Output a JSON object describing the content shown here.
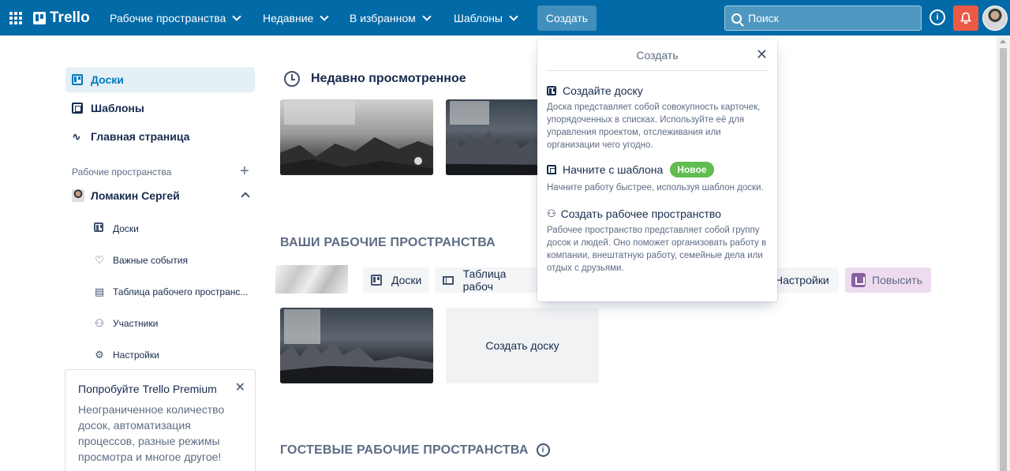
{
  "header": {
    "logo": "Trello",
    "nav": [
      "Рабочие пространства",
      "Недавние",
      "В избранном",
      "Шаблоны"
    ],
    "create": "Создать",
    "search_placeholder": "Поиск",
    "info": "i"
  },
  "sidebar": {
    "items": [
      "Доски",
      "Шаблоны",
      "Главная страница"
    ],
    "workspaces_label": "Рабочие пространства",
    "workspace_name": "Ломакин Сергей",
    "sub_items": [
      "Доски",
      "Важные события",
      "Таблица рабочего пространс...",
      "Участники",
      "Настройки"
    ]
  },
  "promo": {
    "title": "Попробуйте Trello Premium",
    "text": "Неограниченное количество досок, автоматизация процессов, разные режимы просмотра и многое другое!"
  },
  "main": {
    "recent_title": "Недавно просмотренное",
    "your_workspaces": "ВАШИ РАБОЧИЕ ПРОСТРАНСТВА",
    "tabs": [
      "Доски",
      "Таблица рабоч",
      "Настройки"
    ],
    "upgrade": "Повысить",
    "create_board": "Создать доску",
    "guest_workspaces": "ГОСТЕВЫЕ РАБОЧИЕ ПРОСТРАНСТВА"
  },
  "popover": {
    "title": "Создать",
    "items": [
      {
        "title": "Создайте доску",
        "desc": "Доска представляет собой совокупность карточек, упорядоченных в списках. Используйте её для управления проектом, отслеживания или организации чего угодно."
      },
      {
        "title": "Начните с шаблона",
        "badge": "Новое",
        "desc": "Начните работу быстрее, используя шаблон доски."
      },
      {
        "title": "Создать рабочее пространство",
        "desc": "Рабочее пространство представляет собой группу досок и людей. Оно поможет организовать работу в компании, внештатную работу, семейные дела или отдых с друзьями."
      }
    ]
  },
  "colors": {
    "header": "#026aa7",
    "accent": "#0079bf",
    "notification": "#eb5a46",
    "badge": "#61bd4f",
    "upgrade_bg": "#efdbf0"
  }
}
